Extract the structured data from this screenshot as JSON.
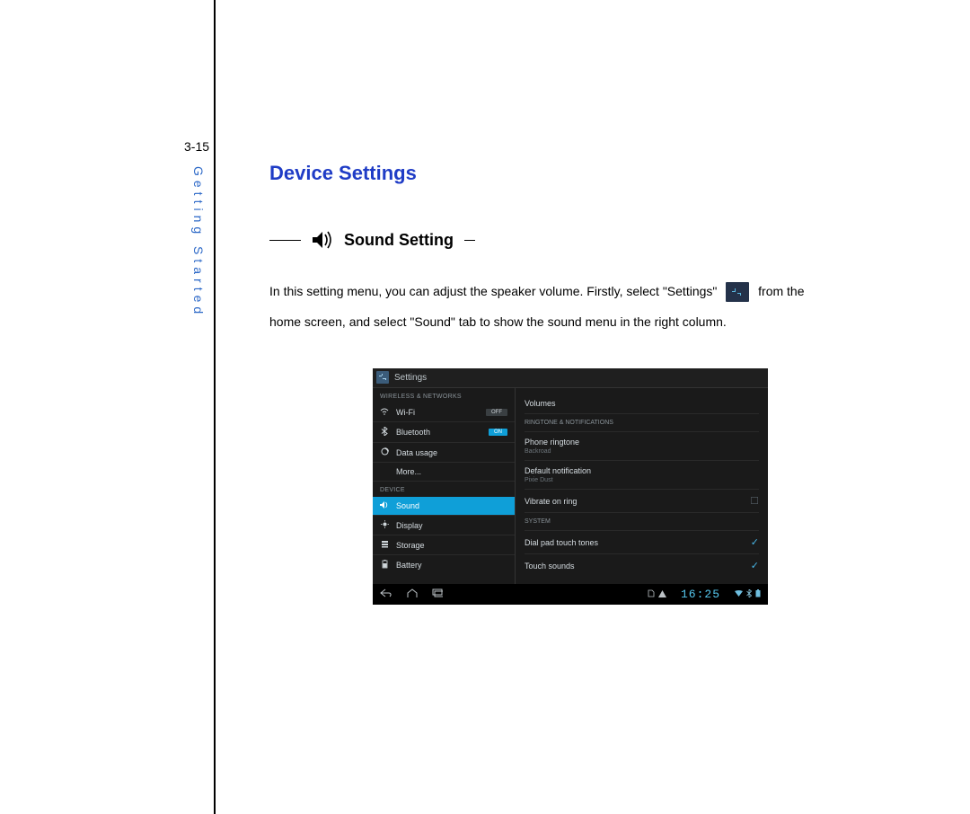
{
  "page_number": "3-15",
  "side_label": "Getting Started",
  "heading": "Device Settings",
  "subheading": "Sound Setting",
  "body_part1": "In this setting menu, you can adjust the speaker volume. Firstly, select \"Settings\"",
  "body_part2": "from the",
  "body_line2": "home screen, and select \"Sound\" tab to show the sound menu in the right column.",
  "shot": {
    "title": "Settings",
    "cat1": "WIRELESS & NETWORKS",
    "wifi": "Wi-Fi",
    "wifi_toggle": "OFF",
    "bt": "Bluetooth",
    "bt_toggle": "ON",
    "data": "Data usage",
    "more": "More...",
    "cat2": "DEVICE",
    "sound": "Sound",
    "display": "Display",
    "storage": "Storage",
    "battery": "Battery",
    "r_volumes": "Volumes",
    "r_cat_ring": "RINGTONE & NOTIFICATIONS",
    "r_ringtone": "Phone ringtone",
    "r_ringtone_sub": "Backroad",
    "r_notif": "Default notification",
    "r_notif_sub": "Pixie Dust",
    "r_vibrate": "Vibrate on ring",
    "r_cat_system": "SYSTEM",
    "r_dial": "Dial pad touch tones",
    "r_touch": "Touch sounds",
    "clock": "16:25"
  }
}
